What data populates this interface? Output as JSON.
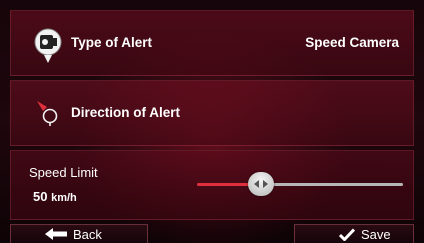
{
  "alert_type": {
    "label": "Type of Alert",
    "value": "Speed Camera",
    "icon": "speed-camera-icon"
  },
  "direction": {
    "label": "Direction of Alert",
    "icon": "direction-marker-icon"
  },
  "speed_limit": {
    "title": "Speed Limit",
    "value": "50",
    "unit": "km/h",
    "slider_fraction": 0.31
  },
  "footer": {
    "back_label": "Back",
    "save_label": "Save"
  },
  "colors": {
    "accent": "#e0303e",
    "row_bg": "#5a0a1c",
    "track": "#b6b6b6"
  }
}
